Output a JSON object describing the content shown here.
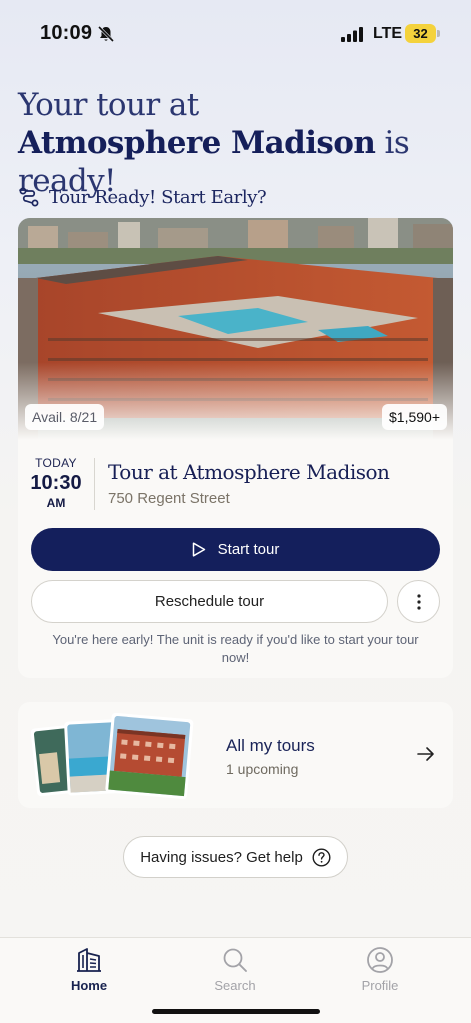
{
  "status_bar": {
    "time": "10:09",
    "network": "LTE",
    "battery": "32",
    "bell_icon": "bell-slash-icon",
    "signal_icon": "cellular-signal-icon",
    "battery_color": "#f4d23c"
  },
  "header": {
    "line1": "Your tour at",
    "property_name": "Atmosphere Madison",
    "suffix": "is ready!"
  },
  "subheader": {
    "icon": "route-icon",
    "text": "Tour Ready! Start Early?"
  },
  "tour_card": {
    "image_icon": "rooftop-pool-photo",
    "availability": "Avail. 8/21",
    "price": "$1,590+",
    "day": "TODAY",
    "time": "10:30",
    "ampm": "AM",
    "title": "Tour at Atmosphere Madison",
    "address": "750 Regent Street",
    "start_button": "Start tour",
    "start_icon": "play-icon",
    "reschedule_button": "Reschedule tour",
    "more_icon": "more-vertical-icon",
    "note": "You're here early! The unit is ready if you'd like to start your tour now!"
  },
  "tours_card": {
    "title": "All my tours",
    "subtitle": "1 upcoming",
    "arrow_icon": "arrow-right-icon"
  },
  "help": {
    "label": "Having issues? Get help",
    "icon": "question-circle-icon"
  },
  "tabbar": {
    "tabs": [
      {
        "label": "Home",
        "icon": "building-icon",
        "active": true
      },
      {
        "label": "Search",
        "icon": "search-icon",
        "active": false
      },
      {
        "label": "Profile",
        "icon": "profile-icon",
        "active": false
      }
    ]
  },
  "colors": {
    "primary": "#141f5c",
    "heading": "#151f5a",
    "muted_text": "#7b7468",
    "background": "#f6f5f3"
  }
}
